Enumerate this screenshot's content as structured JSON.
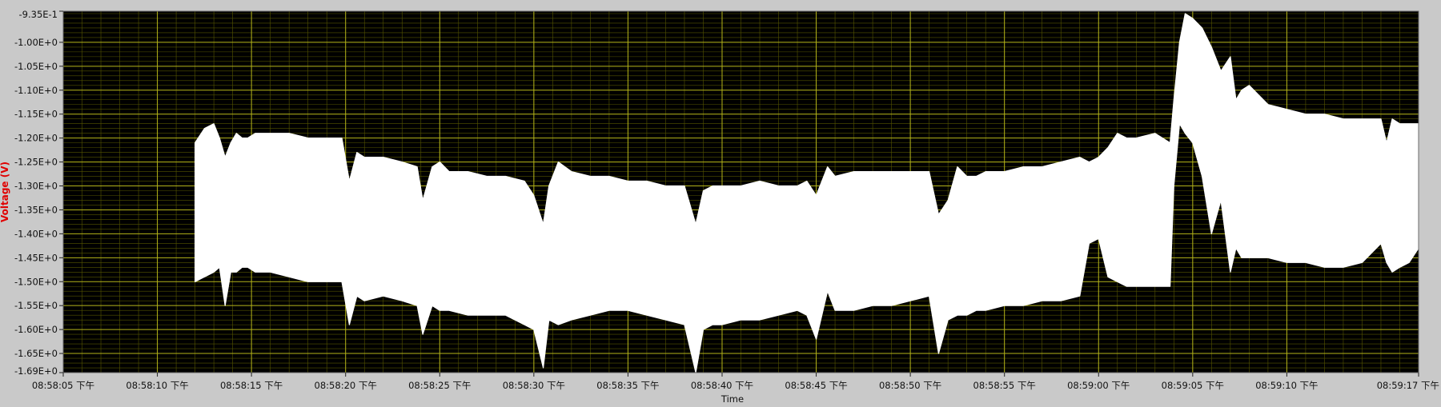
{
  "chart_data": {
    "type": "area",
    "title": "",
    "xlabel": "Time",
    "ylabel": "Voltage (V)",
    "ylim": [
      -1.69,
      -0.935
    ],
    "xlim_seconds": [
      5,
      77
    ],
    "grid": true,
    "colors": {
      "plot_background": "#000000",
      "frame_background": "#c9c9c9",
      "major_grid": "#b3b31a",
      "minor_grid": "#555500",
      "trace": "#ffffff",
      "ylabel": "#e00000"
    },
    "y_ticks": [
      "-9.35E-1",
      "-1.00E+0",
      "-1.05E+0",
      "-1.10E+0",
      "-1.15E+0",
      "-1.20E+0",
      "-1.25E+0",
      "-1.30E+0",
      "-1.35E+0",
      "-1.40E+0",
      "-1.45E+0",
      "-1.50E+0",
      "-1.55E+0",
      "-1.60E+0",
      "-1.65E+0",
      "-1.69E+0"
    ],
    "y_tick_values": [
      -0.935,
      -1.0,
      -1.05,
      -1.1,
      -1.15,
      -1.2,
      -1.25,
      -1.3,
      -1.35,
      -1.4,
      -1.45,
      -1.5,
      -1.55,
      -1.6,
      -1.65,
      -1.69
    ],
    "x_ticks": [
      "08:58:05 下午",
      "08:58:10 下午",
      "08:58:15 下午",
      "08:58:20 下午",
      "08:58:25 下午",
      "08:58:30 下午",
      "08:58:35 下午",
      "08:58:40 下午",
      "08:58:45 下午",
      "08:58:50 下午",
      "08:58:55 下午",
      "08:59:00 下午",
      "08:59:05 下午",
      "08:59:10 下午",
      "08:59:17 下午"
    ],
    "x_tick_seconds": [
      5,
      10,
      15,
      20,
      25,
      30,
      35,
      40,
      45,
      50,
      55,
      60,
      65,
      70,
      77
    ],
    "series": [
      {
        "x_seconds": [
          12.0,
          12.5,
          13.0,
          13.3,
          13.6,
          13.9,
          14.2,
          14.5,
          14.8,
          15.2,
          16.0,
          17.0,
          18.0,
          19.0,
          19.8,
          20.2,
          20.6,
          21.0,
          22.0,
          23.0,
          23.8,
          24.1,
          24.6,
          25.0,
          25.5,
          26.5,
          27.5,
          28.5,
          29.5,
          30.0,
          30.5,
          30.8,
          31.3,
          32.0,
          33.0,
          34.0,
          35.0,
          36.0,
          37.0,
          38.0,
          38.6,
          39.0,
          39.5,
          40.0,
          41.0,
          42.0,
          43.0,
          44.0,
          44.5,
          45.0,
          45.6,
          46.0,
          47.0,
          48.0,
          49.0,
          50.0,
          51.0,
          51.5,
          52.0,
          52.5,
          53.0,
          53.5,
          54.0,
          55.0,
          56.0,
          57.0,
          58.0,
          59.0,
          59.5,
          60.0,
          60.5,
          61.0,
          61.5,
          62.0,
          63.0,
          63.8,
          64.0,
          64.3,
          64.6,
          65.0,
          65.5,
          66.0,
          66.5,
          67.0,
          67.3,
          67.6,
          68.0,
          69.0,
          70.0,
          71.0,
          72.0,
          73.0,
          74.0,
          75.0,
          75.3,
          75.6,
          76.0,
          76.5,
          77.0
        ],
        "upper": [
          -1.21,
          -1.18,
          -1.17,
          -1.2,
          -1.24,
          -1.21,
          -1.19,
          -1.2,
          -1.2,
          -1.19,
          -1.19,
          -1.19,
          -1.2,
          -1.2,
          -1.2,
          -1.29,
          -1.23,
          -1.24,
          -1.24,
          -1.25,
          -1.26,
          -1.33,
          -1.26,
          -1.25,
          -1.27,
          -1.27,
          -1.28,
          -1.28,
          -1.29,
          -1.32,
          -1.38,
          -1.3,
          -1.25,
          -1.27,
          -1.28,
          -1.28,
          -1.29,
          -1.29,
          -1.3,
          -1.3,
          -1.38,
          -1.31,
          -1.3,
          -1.3,
          -1.3,
          -1.29,
          -1.3,
          -1.3,
          -1.29,
          -1.32,
          -1.26,
          -1.28,
          -1.27,
          -1.27,
          -1.27,
          -1.27,
          -1.27,
          -1.36,
          -1.33,
          -1.26,
          -1.28,
          -1.28,
          -1.27,
          -1.27,
          -1.26,
          -1.26,
          -1.25,
          -1.24,
          -1.25,
          -1.24,
          -1.22,
          -1.19,
          -1.2,
          -1.2,
          -1.19,
          -1.21,
          -1.12,
          -1.0,
          -0.94,
          -0.95,
          -0.97,
          -1.01,
          -1.06,
          -1.03,
          -1.12,
          -1.1,
          -1.09,
          -1.13,
          -1.14,
          -1.15,
          -1.15,
          -1.16,
          -1.16,
          -1.16,
          -1.21,
          -1.16,
          -1.17,
          -1.17,
          -1.17
        ],
        "lower": [
          -1.5,
          -1.49,
          -1.48,
          -1.47,
          -1.55,
          -1.48,
          -1.48,
          -1.47,
          -1.47,
          -1.48,
          -1.48,
          -1.49,
          -1.5,
          -1.5,
          -1.5,
          -1.59,
          -1.53,
          -1.54,
          -1.53,
          -1.54,
          -1.55,
          -1.61,
          -1.55,
          -1.56,
          -1.56,
          -1.57,
          -1.57,
          -1.57,
          -1.59,
          -1.6,
          -1.68,
          -1.58,
          -1.59,
          -1.58,
          -1.57,
          -1.56,
          -1.56,
          -1.57,
          -1.58,
          -1.59,
          -1.69,
          -1.6,
          -1.59,
          -1.59,
          -1.58,
          -1.58,
          -1.57,
          -1.56,
          -1.57,
          -1.62,
          -1.52,
          -1.56,
          -1.56,
          -1.55,
          -1.55,
          -1.54,
          -1.53,
          -1.65,
          -1.58,
          -1.57,
          -1.57,
          -1.56,
          -1.56,
          -1.55,
          -1.55,
          -1.54,
          -1.54,
          -1.53,
          -1.42,
          -1.41,
          -1.49,
          -1.5,
          -1.51,
          -1.51,
          -1.51,
          -1.51,
          -1.3,
          -1.17,
          -1.19,
          -1.21,
          -1.28,
          -1.4,
          -1.33,
          -1.48,
          -1.43,
          -1.45,
          -1.45,
          -1.45,
          -1.46,
          -1.46,
          -1.47,
          -1.47,
          -1.46,
          -1.42,
          -1.46,
          -1.48,
          -1.47,
          -1.46,
          -1.43
        ]
      }
    ]
  }
}
